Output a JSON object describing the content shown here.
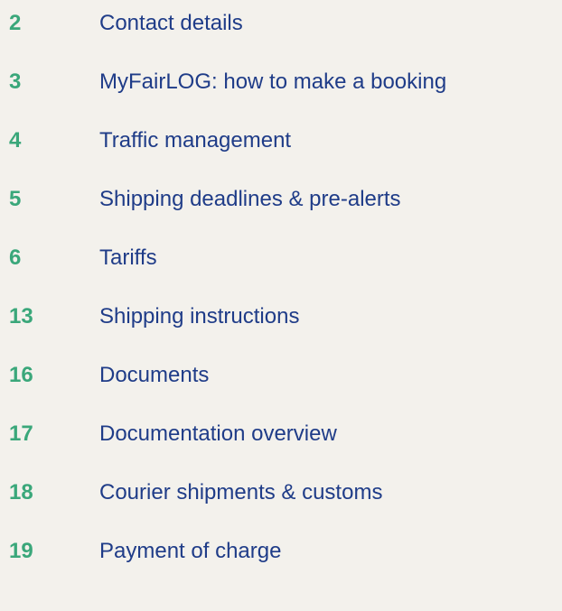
{
  "toc": {
    "entries": [
      {
        "page": "2",
        "title": "Contact details"
      },
      {
        "page": "3",
        "title": "MyFairLOG: how to make a booking"
      },
      {
        "page": "4",
        "title": "Traffic management"
      },
      {
        "page": "5",
        "title": "Shipping deadlines & pre-alerts"
      },
      {
        "page": "6",
        "title": "Tariffs"
      },
      {
        "page": "13",
        "title": "Shipping instructions"
      },
      {
        "page": "16",
        "title": "Documents"
      },
      {
        "page": "17",
        "title": "Documentation overview"
      },
      {
        "page": "18",
        "title": "Courier shipments & customs"
      },
      {
        "page": "19",
        "title": "Payment of charge"
      }
    ]
  },
  "colors": {
    "background": "#f3f1ec",
    "page_number": "#3aa77a",
    "title": "#1f3c88"
  }
}
